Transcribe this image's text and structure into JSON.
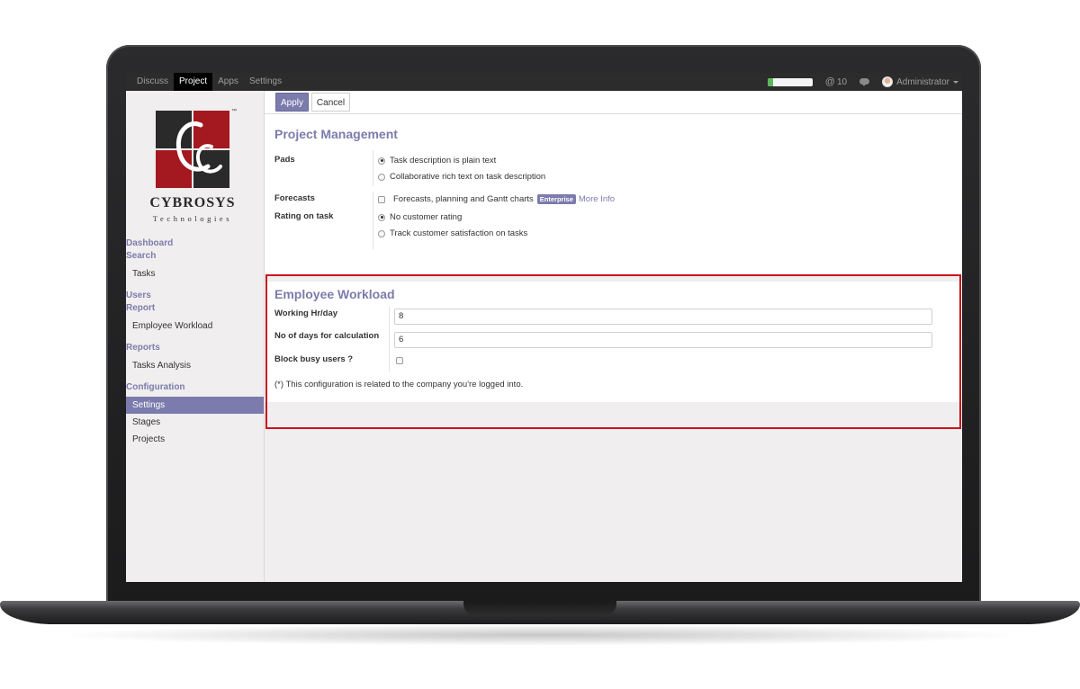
{
  "topbar": {
    "nav": [
      "Discuss",
      "Project",
      "Apps",
      "Settings"
    ],
    "active_nav": "Project",
    "progress_fraction": 0.12,
    "mention_count": "10",
    "user_name": "Administrator"
  },
  "logo": {
    "name": "CYBROSYS",
    "subtitle": "Technologies",
    "tm": "™"
  },
  "sidebar": {
    "sections": [
      {
        "title": [
          "Dashboard",
          "Search"
        ],
        "items": [
          "Tasks"
        ]
      },
      {
        "title": [
          "Users",
          "Report"
        ],
        "items": [
          "Employee Workload"
        ]
      },
      {
        "title": [
          "Reports"
        ],
        "items": [
          "Tasks Analysis"
        ]
      },
      {
        "title": [
          "Configuration"
        ],
        "items": [
          "Settings",
          "Stages",
          "Projects"
        ]
      }
    ],
    "active_item": "Settings"
  },
  "toolbar": {
    "apply_label": "Apply",
    "cancel_label": "Cancel"
  },
  "project_management": {
    "heading": "Project Management",
    "pads_label": "Pads",
    "pads_options": [
      {
        "label": "Task description is plain text",
        "checked": true
      },
      {
        "label": "Collaborative rich text on task description",
        "checked": false
      }
    ],
    "forecasts_label": "Forecasts",
    "forecasts_option": "Forecasts, planning and Gantt charts",
    "forecasts_badge": "Enterprise",
    "forecasts_link": "More Info",
    "rating_label": "Rating on task",
    "rating_options": [
      {
        "label": "No customer rating",
        "checked": true
      },
      {
        "label": "Track customer satisfaction on tasks",
        "checked": false
      }
    ]
  },
  "employee_workload": {
    "heading": "Employee Workload",
    "working_hr_label": "Working Hr/day",
    "working_hr_value": "8",
    "days_label": "No of days for calculation",
    "days_value": "6",
    "block_label": "Block busy users ?",
    "block_checked": false,
    "note": "(*) This configuration is related to the company you're logged into."
  },
  "colors": {
    "accent": "#7c7bad",
    "highlight_border": "#c9141e",
    "logo_red": "#a3191f",
    "logo_dark": "#2a2a2a"
  }
}
